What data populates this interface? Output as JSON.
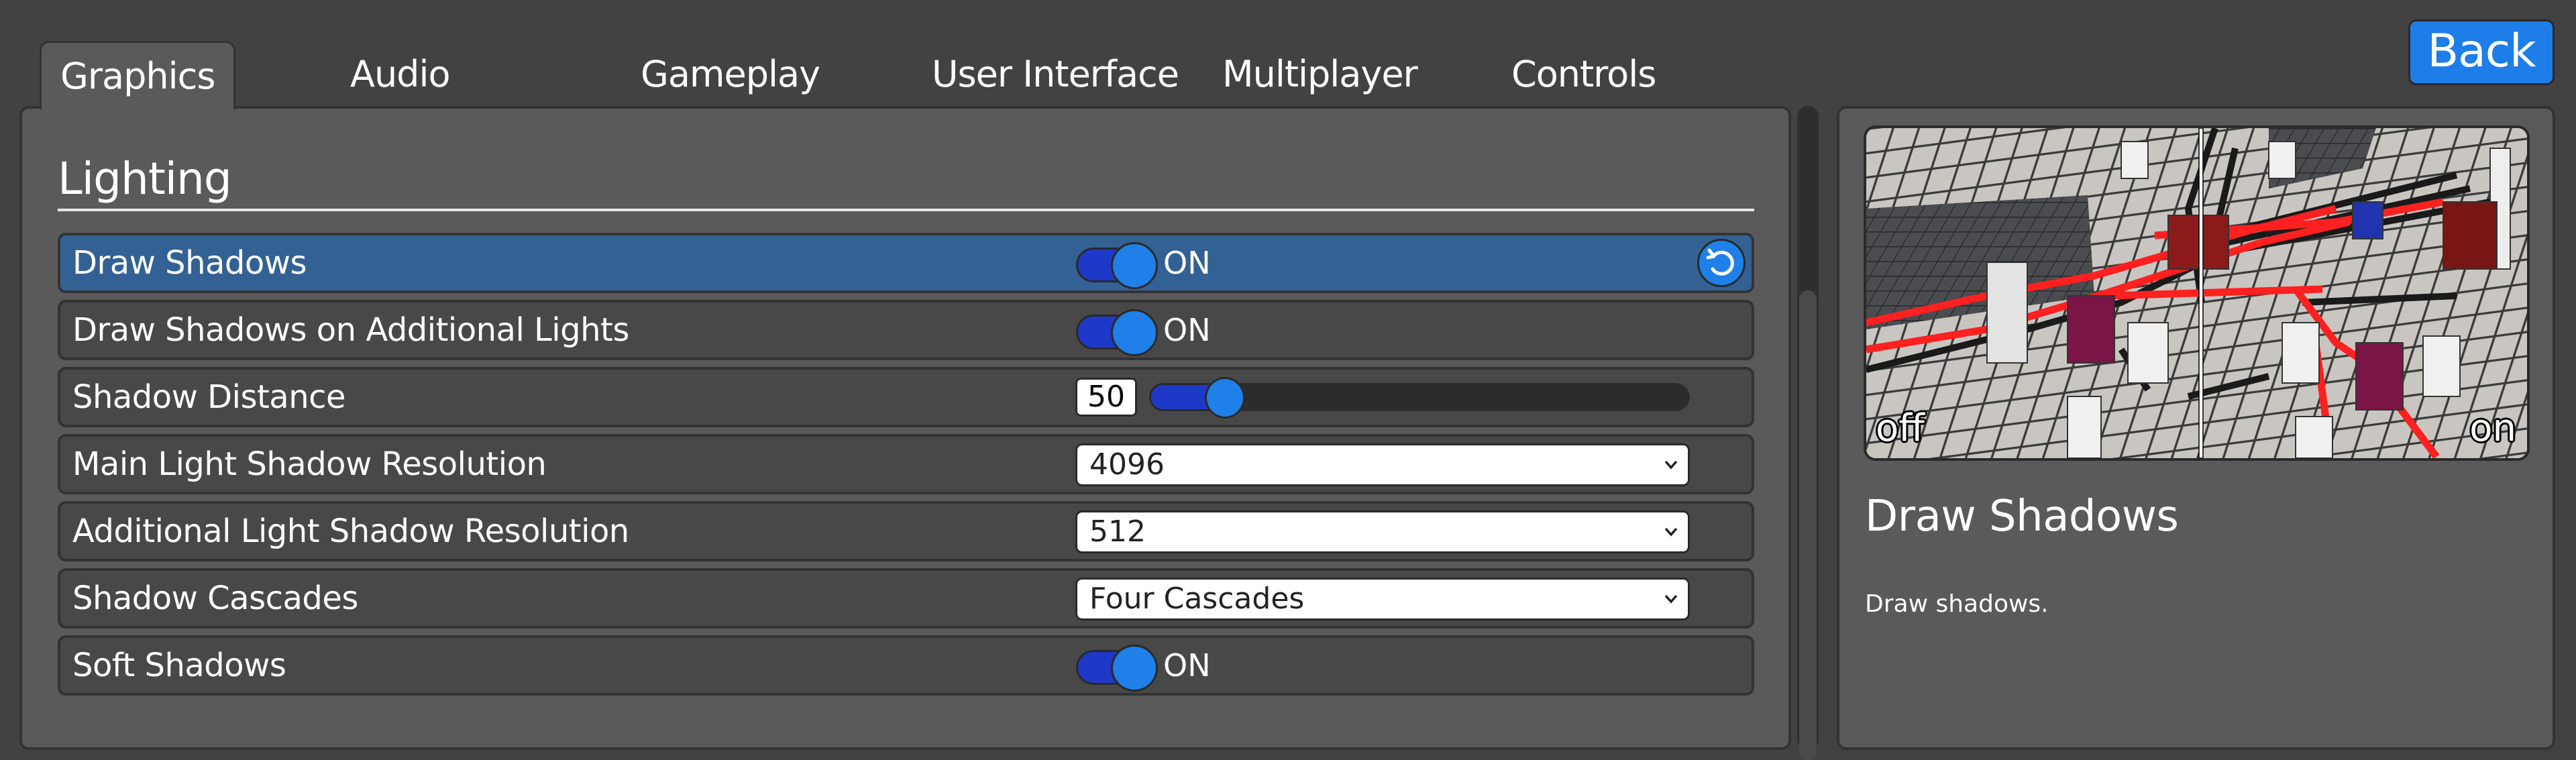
{
  "tabs": [
    {
      "label": "Graphics",
      "active": true
    },
    {
      "label": "Audio",
      "active": false
    },
    {
      "label": "Gameplay",
      "active": false
    },
    {
      "label": "User Interface",
      "active": false
    },
    {
      "label": "Multiplayer",
      "active": false
    },
    {
      "label": "Controls",
      "active": false
    }
  ],
  "back_label": "Back",
  "section": {
    "title": "Lighting",
    "settings": [
      {
        "label": "Draw Shadows",
        "control": "toggle",
        "value": "ON",
        "selected": true,
        "reset_icon": "reset-icon"
      },
      {
        "label": "Draw Shadows on Additional Lights",
        "control": "toggle",
        "value": "ON"
      },
      {
        "label": "Shadow Distance",
        "control": "slider",
        "value": "50",
        "fill_fraction": 0.14
      },
      {
        "label": "Main Light Shadow Resolution",
        "control": "dropdown",
        "value": "4096"
      },
      {
        "label": "Additional Light Shadow Resolution",
        "control": "dropdown",
        "value": "512"
      },
      {
        "label": "Shadow Cascades",
        "control": "dropdown",
        "value": "Four Cascades"
      },
      {
        "label": "Soft Shadows",
        "control": "toggle",
        "value": "ON"
      }
    ]
  },
  "detail": {
    "preview_off_label": "off",
    "preview_on_label": "on",
    "title": "Draw Shadows",
    "description": "Draw shadows."
  },
  "colors": {
    "accent": "#1e80e8",
    "toggle_track": "#1e38c8",
    "selected_row": "#336194",
    "back_button": "#1e7de8"
  }
}
